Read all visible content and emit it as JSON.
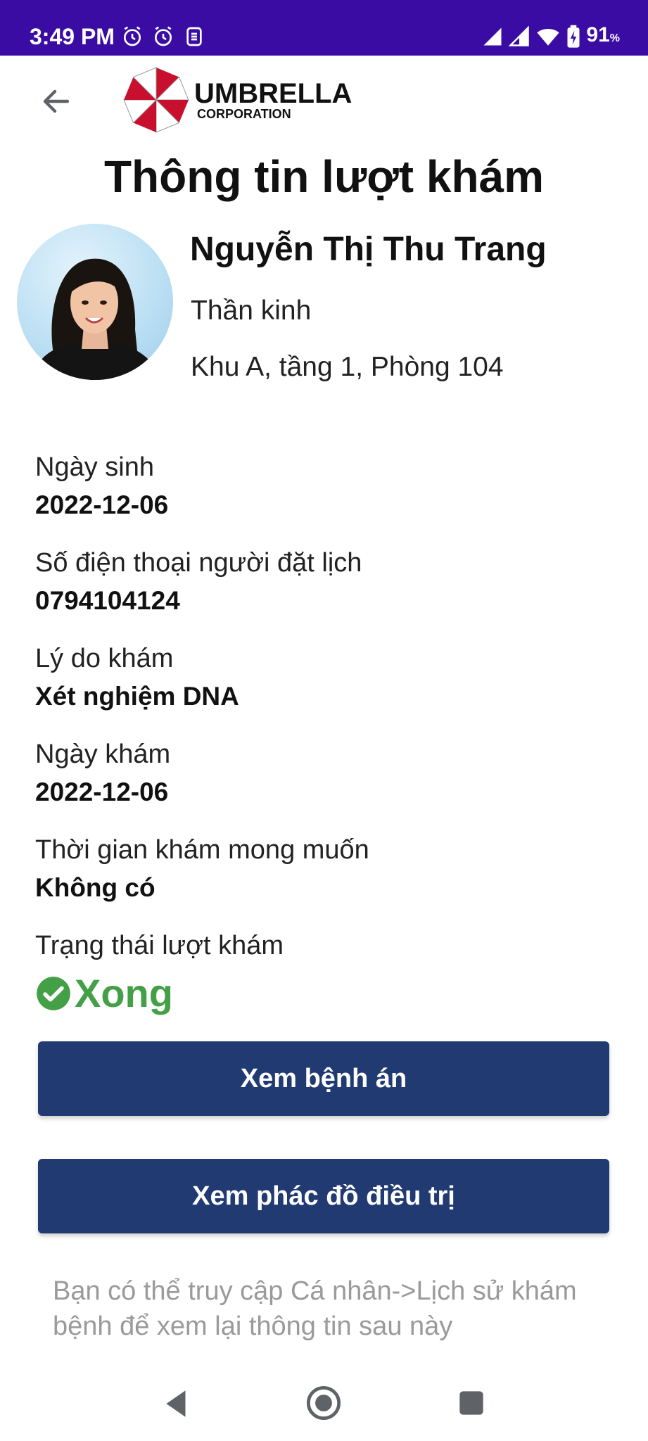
{
  "status_bar": {
    "time": "3:49 PM",
    "battery_percent": "91",
    "battery_unit": "%",
    "icons_left": [
      "alarm-icon",
      "alarm-icon",
      "sync-icon"
    ],
    "icons_right": [
      "signal-icon",
      "signal-icon",
      "wifi-icon",
      "battery-charging-icon"
    ]
  },
  "header": {
    "back_icon": "arrow-left-icon",
    "logo_name": "UMBRELLA",
    "logo_subtitle": "CORPORATION",
    "title": "Thông tin lượt khám"
  },
  "doctor": {
    "name": "Nguyễn Thị Thu Trang",
    "specialty": "Thần kinh",
    "room": "Khu A, tầng 1, Phòng 104"
  },
  "fields": {
    "dob": {
      "label": "Ngày sinh",
      "value": "2022-12-06"
    },
    "phone": {
      "label": "Số điện thoại người đặt lịch",
      "value": "0794104124"
    },
    "reason": {
      "label": "Lý do khám",
      "value": "Xét nghiệm DNA"
    },
    "visit_date": {
      "label": "Ngày khám",
      "value": "2022-12-06"
    },
    "preferred_time": {
      "label": "Thời gian khám mong muốn",
      "value": "Không có"
    },
    "status": {
      "label": "Trạng thái lượt khám",
      "value": "Xong",
      "icon": "check-circle-icon",
      "color": "#43a047"
    }
  },
  "buttons": {
    "view_records": "Xem bệnh án",
    "view_treatment": "Xem phác đồ điều trị"
  },
  "hint": "Bạn có thể truy cập Cá nhân->Lịch sử khám bệnh để xem lại thông tin sau này",
  "colors": {
    "status_bar": "#3a0ca3",
    "primary_button": "#213a72",
    "success": "#43a047",
    "hint": "#9a9a9a",
    "logo_red": "#c8102e"
  },
  "nav_bar": {
    "icons": [
      "nav-back-icon",
      "nav-home-icon",
      "nav-recents-icon"
    ]
  }
}
